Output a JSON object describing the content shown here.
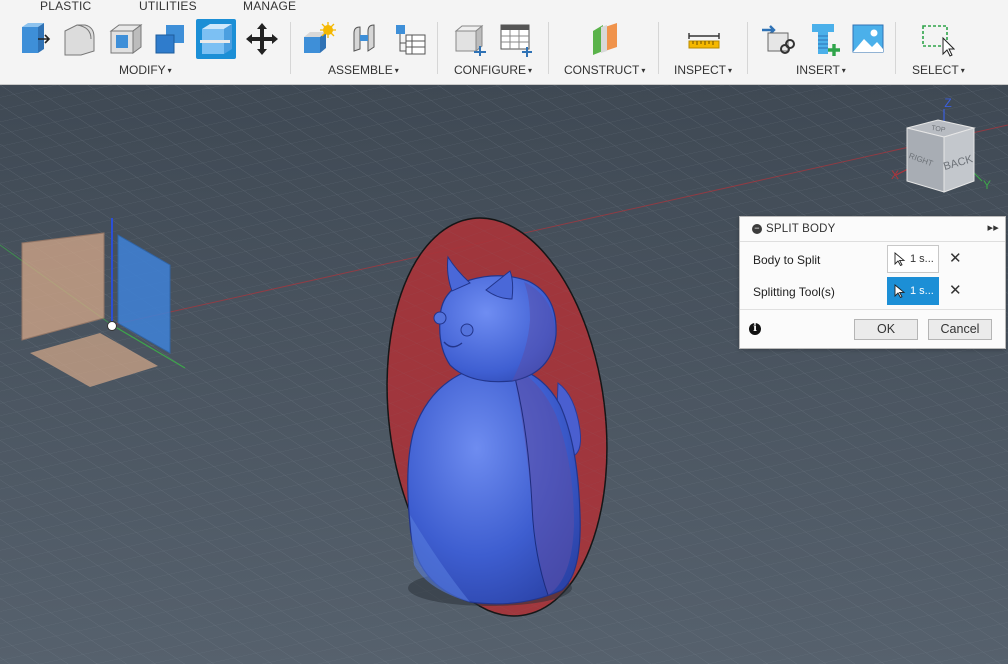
{
  "toolbar": {
    "tabs": [
      "PLASTIC",
      "UTILITIES",
      "MANAGE"
    ],
    "groups": {
      "modify": "MODIFY",
      "assemble": "ASSEMBLE",
      "configure": "CONFIGURE",
      "construct": "CONSTRUCT",
      "inspect": "INSPECT",
      "insert": "INSERT",
      "select": "SELECT"
    },
    "caret": "▾",
    "tools": [
      "press-pull-icon",
      "fillet-icon",
      "shell-icon",
      "combine-icon",
      "split-body-icon",
      "move-icon",
      "new-component-icon",
      "joint-icon",
      "parameters-table-icon",
      "configure-box-icon",
      "configure-table-icon",
      "plane-icon",
      "measure-icon",
      "insert-derive-icon",
      "insert-mcmaster-icon",
      "insert-canvas-icon",
      "select-window-icon"
    ]
  },
  "viewcube": {
    "right": "RIGHT",
    "back": "BACK",
    "top": "TOP",
    "z": "Z",
    "x": "X",
    "y": "Y"
  },
  "dialog": {
    "title": "SPLIT BODY",
    "expand": "▸▸",
    "collapse_symbol": "−",
    "body_to_split_label": "Body to Split",
    "body_to_split_value": "1 s...",
    "splitting_tool_label": "Splitting Tool(s)",
    "splitting_tool_value": "1 s...",
    "clear": "✕",
    "info": "i",
    "ok": "OK",
    "cancel": "Cancel"
  },
  "colors": {
    "toolbar_bg": "#f4f4f4",
    "viewport_bg": "#4f5a66",
    "accent": "#1c8fd6",
    "body_blue": "#3f62d2",
    "split_plane_red": "#a8343a"
  }
}
